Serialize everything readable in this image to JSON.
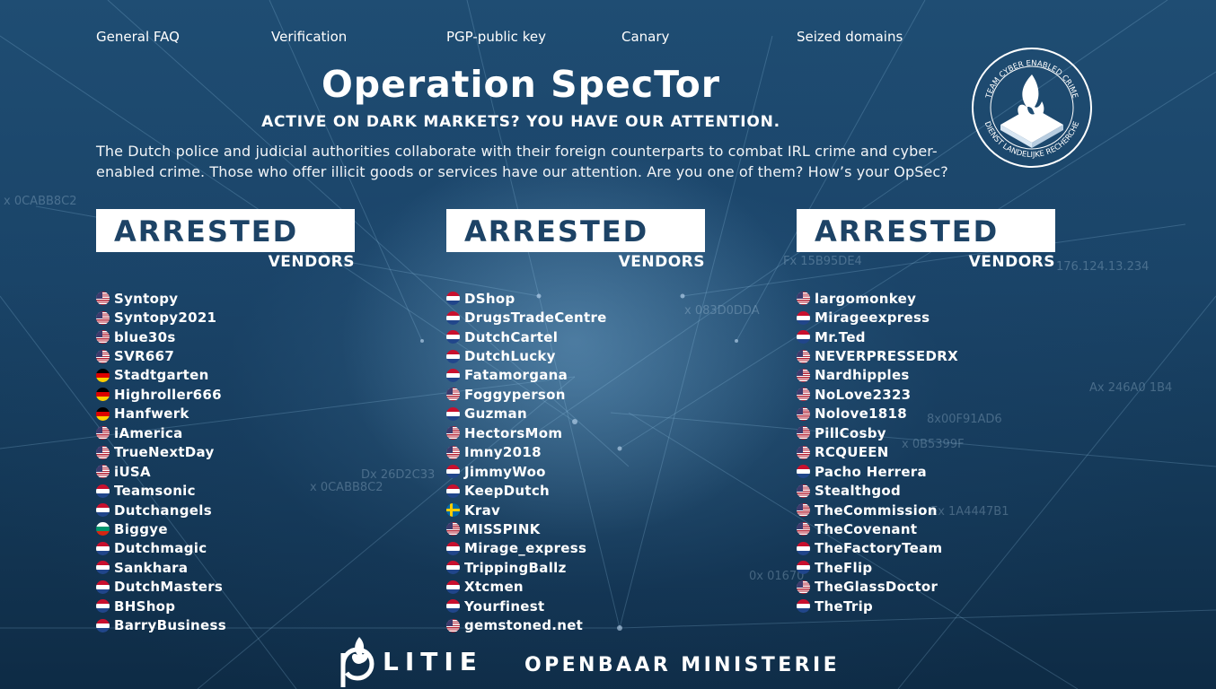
{
  "nav": {
    "items": [
      "General FAQ",
      "Verification",
      "PGP-public key",
      "Canary",
      "Seized domains"
    ]
  },
  "header": {
    "title": "Operation SpecTor",
    "subtitle": "ACTIVE ON DARK MARKETS? YOU HAVE OUR ATTENTION.",
    "intro": "The Dutch police and judicial authorities collaborate with their foreign counterparts to combat IRL crime and cyber-enabled crime. Those who offer illicit goods or services have our attention. Are you one of them? How’s your OpSec?"
  },
  "seal": {
    "top_text": "TEAM CYBER ENABLED CRIME",
    "bottom_text": "DIENST LANDELIJKE RECHERCHE"
  },
  "columns": [
    {
      "heading": "ARRESTED",
      "subheading": "VENDORS",
      "vendors": [
        {
          "name": "Syntopy",
          "flag": "us"
        },
        {
          "name": "Syntopy2021",
          "flag": "us"
        },
        {
          "name": "blue30s",
          "flag": "us"
        },
        {
          "name": "SVR667",
          "flag": "us"
        },
        {
          "name": "Stadtgarten",
          "flag": "de"
        },
        {
          "name": "Highroller666",
          "flag": "de"
        },
        {
          "name": "Hanfwerk",
          "flag": "de"
        },
        {
          "name": "iAmerica",
          "flag": "us"
        },
        {
          "name": "TrueNextDay",
          "flag": "us"
        },
        {
          "name": "iUSA",
          "flag": "us"
        },
        {
          "name": "Teamsonic",
          "flag": "nl"
        },
        {
          "name": "Dutchangels",
          "flag": "nl"
        },
        {
          "name": "Biggye",
          "flag": "bg"
        },
        {
          "name": "Dutchmagic",
          "flag": "nl"
        },
        {
          "name": "Sankhara",
          "flag": "nl"
        },
        {
          "name": "DutchMasters",
          "flag": "nl"
        },
        {
          "name": "BHShop",
          "flag": "nl"
        },
        {
          "name": "BarryBusiness",
          "flag": "nl"
        }
      ]
    },
    {
      "heading": "ARRESTED",
      "subheading": "VENDORS",
      "vendors": [
        {
          "name": "DShop",
          "flag": "nl"
        },
        {
          "name": "DrugsTradeCentre",
          "flag": "nl"
        },
        {
          "name": "DutchCartel",
          "flag": "nl"
        },
        {
          "name": "DutchLucky",
          "flag": "nl"
        },
        {
          "name": "Fatamorgana",
          "flag": "nl"
        },
        {
          "name": "Foggyperson",
          "flag": "us"
        },
        {
          "name": "Guzman",
          "flag": "nl"
        },
        {
          "name": "HectorsMom",
          "flag": "us"
        },
        {
          "name": "Imny2018",
          "flag": "us"
        },
        {
          "name": "JimmyWoo",
          "flag": "nl"
        },
        {
          "name": "KeepDutch",
          "flag": "nl"
        },
        {
          "name": "Krav",
          "flag": "se"
        },
        {
          "name": "MISSPINK",
          "flag": "us"
        },
        {
          "name": "Mirage_express",
          "flag": "nl"
        },
        {
          "name": "TrippingBallz",
          "flag": "nl"
        },
        {
          "name": "Xtcmen",
          "flag": "nl"
        },
        {
          "name": "Yourfinest",
          "flag": "nl"
        },
        {
          "name": "gemstoned.net",
          "flag": "us"
        }
      ]
    },
    {
      "heading": "ARRESTED",
      "subheading": "VENDORS",
      "vendors": [
        {
          "name": "largomonkey",
          "flag": "us"
        },
        {
          "name": "Mirageexpress",
          "flag": "nl"
        },
        {
          "name": "Mr.Ted",
          "flag": "nl"
        },
        {
          "name": "NEVERPRESSEDRX",
          "flag": "us"
        },
        {
          "name": "Nardhipples",
          "flag": "us"
        },
        {
          "name": "NoLove2323",
          "flag": "us"
        },
        {
          "name": "Nolove1818",
          "flag": "us"
        },
        {
          "name": "PillCosby",
          "flag": "us"
        },
        {
          "name": "RCQUEEN",
          "flag": "us"
        },
        {
          "name": "Pacho Herrera",
          "flag": "nl"
        },
        {
          "name": "Stealthgod",
          "flag": "us"
        },
        {
          "name": "TheCommission",
          "flag": "us"
        },
        {
          "name": "TheCovenant",
          "flag": "us"
        },
        {
          "name": "TheFactoryTeam",
          "flag": "nl"
        },
        {
          "name": "TheFlip",
          "flag": "nl"
        },
        {
          "name": "TheGlassDoctor",
          "flag": "us"
        },
        {
          "name": "TheTrip",
          "flag": "nl"
        }
      ]
    }
  ],
  "background_labels": [
    "x 0CABB8C2",
    "Fx 15B95DE4",
    "Ax 246A0 1B4",
    "Dx 26D2C33",
    "Ex 1A4447B1",
    "x 0CABB8C2",
    "176.124.13.234",
    "8x00F91AD6",
    "x 083D0DDA",
    "x 0B5399F",
    "0x 01670"
  ],
  "footer": {
    "politie": "LITIE",
    "om": "OPENBAAR MINISTERIE"
  }
}
